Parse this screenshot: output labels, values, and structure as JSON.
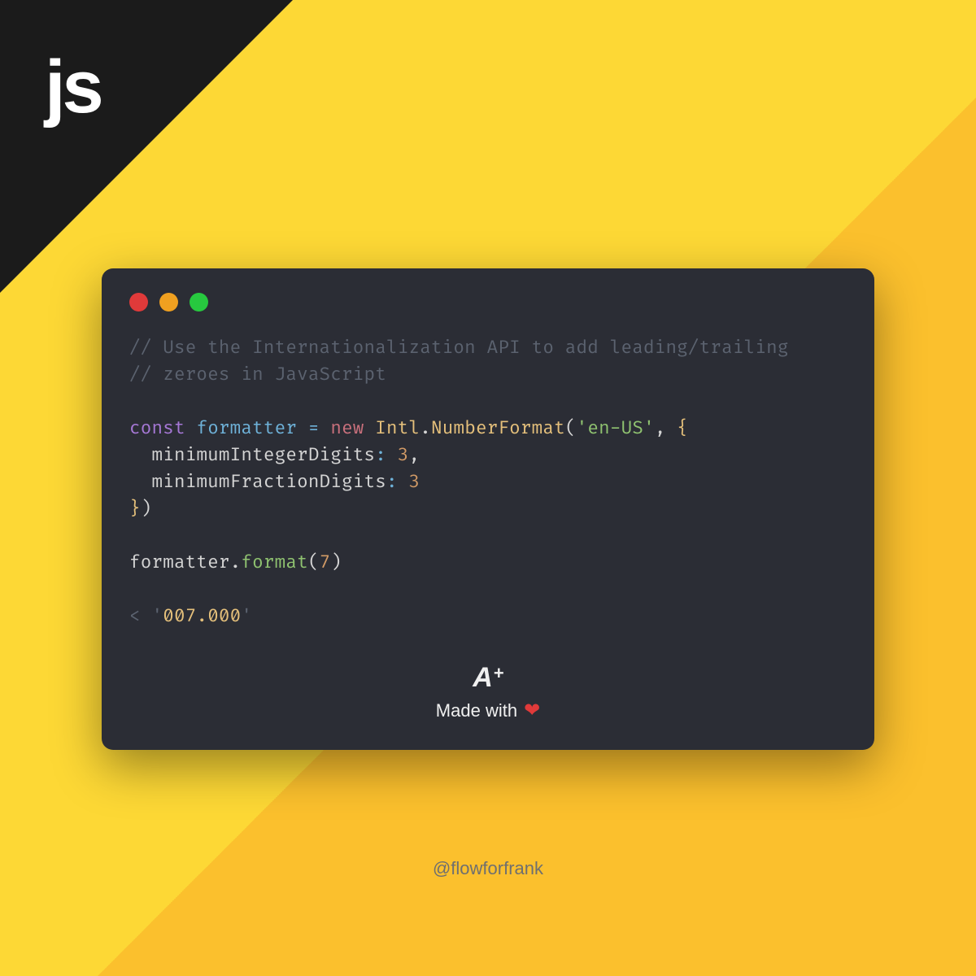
{
  "corner": {
    "language_label": "js"
  },
  "window": {
    "controls": {
      "close": "close",
      "minimize": "minimize",
      "maximize": "maximize"
    }
  },
  "code": {
    "comment1": "// Use the Internationalization API to add leading/trailing",
    "comment2": "// zeroes in JavaScript",
    "kw_const": "const",
    "var_name": "formatter",
    "op_eq": " = ",
    "kw_new": "new",
    "sp": " ",
    "cls_intl": "Intl",
    "dot": ".",
    "cls_nf": "NumberFormat",
    "paren_open": "(",
    "str_locale": "'en-US'",
    "comma_sp": ", ",
    "brace_open": "{",
    "indent": "  ",
    "prop_minInt": "minimumIntegerDigits",
    "colon_sp": ": ",
    "num_3a": "3",
    "comma": ",",
    "prop_minFrac": "minimumFractionDigits",
    "num_3b": "3",
    "brace_close": "}",
    "paren_close": ")",
    "var_formatter": "formatter",
    "method_format": "format",
    "num_7": "7",
    "result_prefix": "< ",
    "result_q1": "'",
    "result_val": "007.000",
    "result_q2": "'"
  },
  "brand": {
    "logo_a": "A",
    "logo_plus": "+",
    "made_with": "Made with",
    "heart": "❤"
  },
  "handle": "@flowforfrank"
}
